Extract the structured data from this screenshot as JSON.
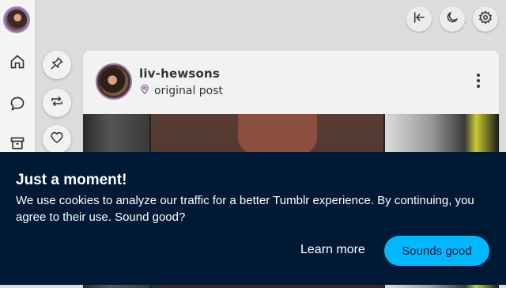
{
  "header": {
    "collapse_icon": "collapse-left-icon",
    "theme_icon": "moon-icon",
    "settings_icon": "gear-icon"
  },
  "sidebar": {
    "items": [
      {
        "icon": "home-icon"
      },
      {
        "icon": "chat-icon"
      },
      {
        "icon": "archive-icon"
      }
    ]
  },
  "post_actions": [
    {
      "icon": "pin-icon"
    },
    {
      "icon": "reblog-icon"
    },
    {
      "icon": "heart-icon"
    }
  ],
  "post": {
    "username": "liv-hewsons",
    "label": "original post",
    "menu_icon": "kebab-icon"
  },
  "cookie_banner": {
    "title": "Just a moment!",
    "message": "We use cookies to analyze our traffic for a better Tumblr experience. By continuing, you agree to their use. Sound good?",
    "learn_more": "Learn more",
    "accept": "Sounds good"
  },
  "colors": {
    "banner_bg": "#001935",
    "accept_bg": "#00b8ff",
    "avatar_ring": "#9a7ab4"
  }
}
